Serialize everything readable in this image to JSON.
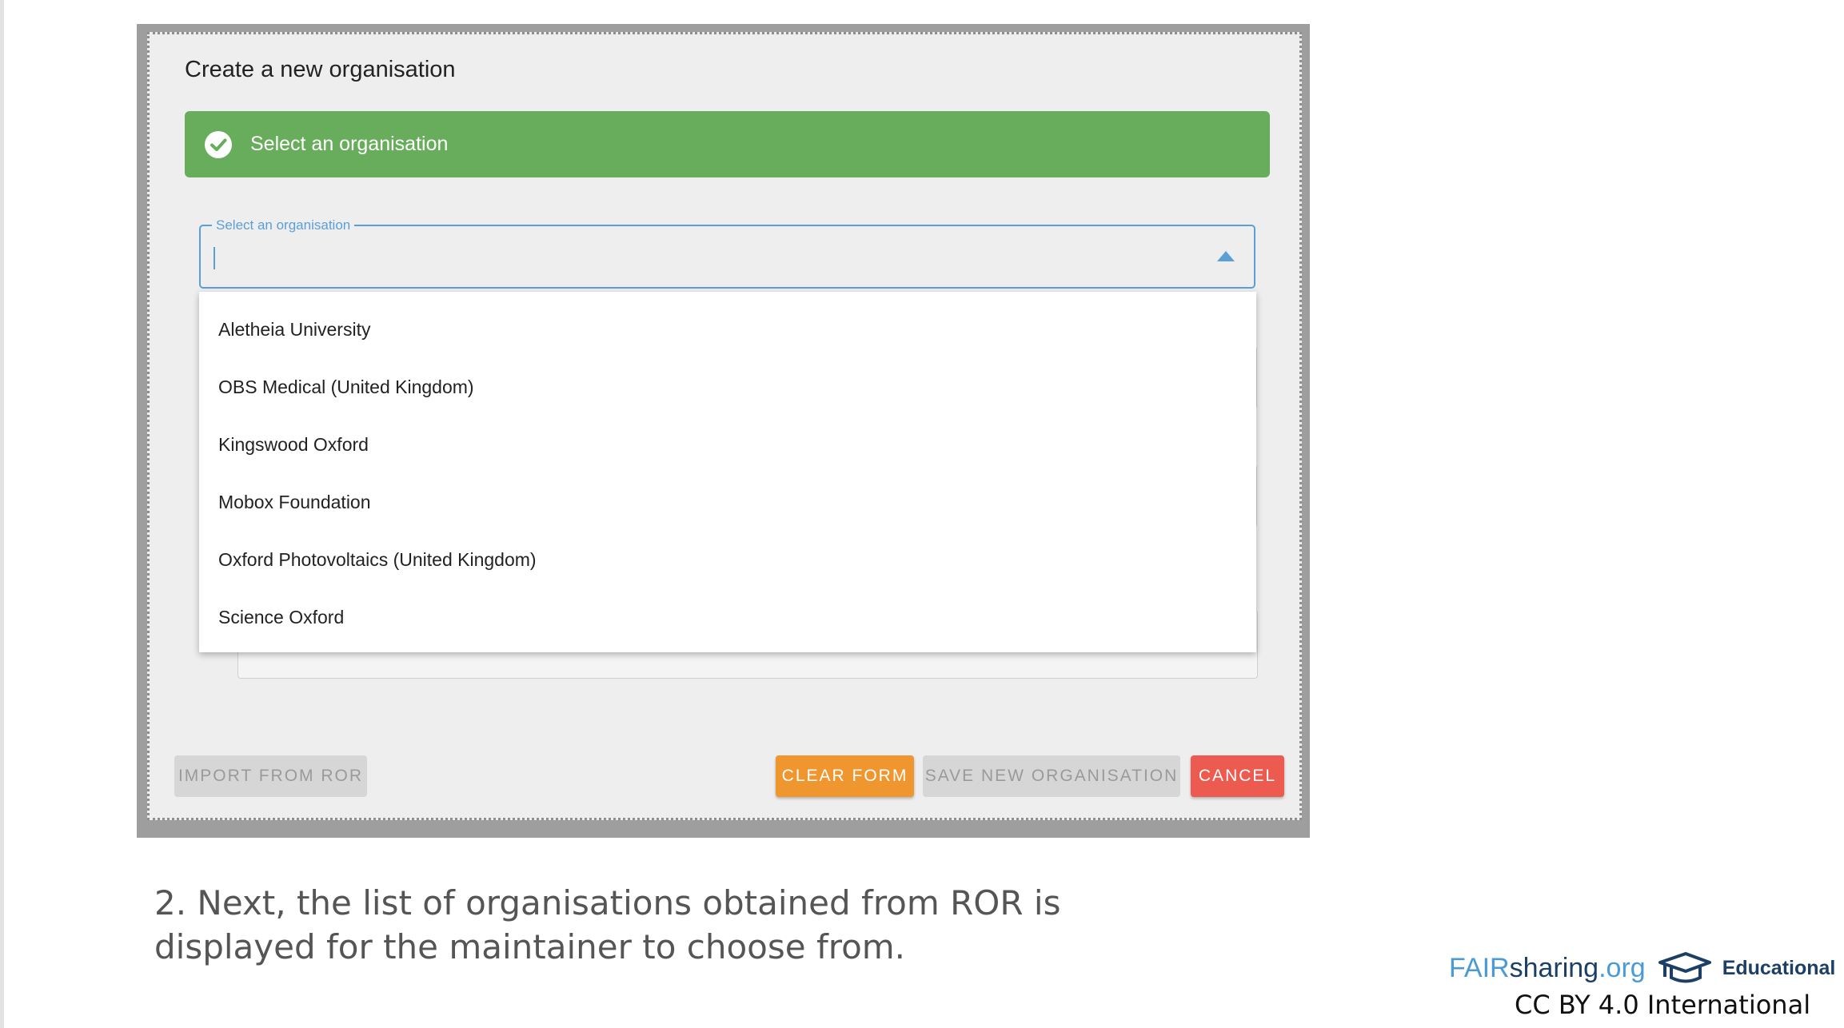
{
  "dialog": {
    "title": "Create a new organisation",
    "status_message": "Select an organisation",
    "status_color": "#68ad5b"
  },
  "select": {
    "label": "Select an organisation",
    "value": "",
    "accent_color": "#5b9fd6"
  },
  "options": [
    "Aletheia University",
    "OBS Medical (United Kingdom)",
    "Kingswood Oxford",
    "Mobox Foundation",
    "Oxford Photovoltaics (United Kingdom)",
    "Science Oxford"
  ],
  "buttons": {
    "import": "IMPORT FROM ROR",
    "clear": "CLEAR FORM",
    "save": "SAVE NEW ORGANISATION",
    "cancel": "CANCEL",
    "clear_color": "#f0962e",
    "cancel_color": "#ed5a4f"
  },
  "caption": "2. Next, the list of organisations obtained from ROR is displayed for the maintainer to choose from.",
  "footer": {
    "brand_fair": "FAIR",
    "brand_sharing": "sharing",
    "brand_org": ".org",
    "brand_tag": "Educational",
    "license": "CC BY 4.0 International",
    "icon": "graduation-cap-icon"
  }
}
